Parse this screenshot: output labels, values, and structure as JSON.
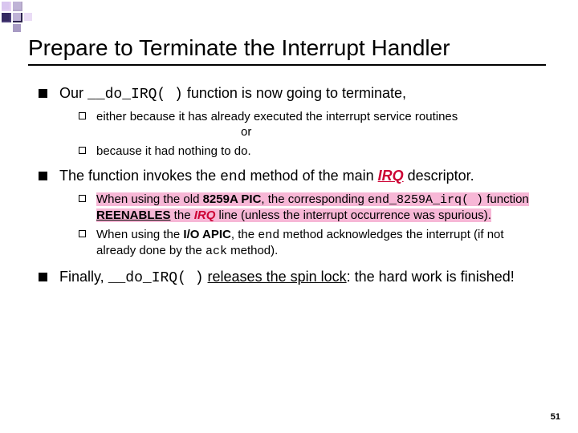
{
  "title": "Prepare to Terminate the Interrupt Handler",
  "b1": {
    "pre": "Our ",
    "code": "__do_IRQ( )",
    "post": " function is now going to terminate,",
    "sub1a": "either because it has already executed the interrupt service routines",
    "sub1b": "or",
    "sub2": "because it had nothing to do."
  },
  "b2": {
    "pre": "The function invokes the ",
    "code": "end",
    "mid": " method of the main ",
    "irq": "IRQ",
    "post": " descriptor.",
    "sub1_a": "When using the old ",
    "sub1_b": "8259A PIC",
    "sub1_c": ", the corresponding ",
    "sub1_code": "end_8259A_irq( )",
    "sub1_d": " function ",
    "sub1_e": "REENABLES",
    "sub1_f": " the ",
    "sub1_irq": "IRQ",
    "sub1_g": " line (unless the interrupt occurrence was spurious).",
    "sub2_a": "When using the ",
    "sub2_b": "I/O APIC",
    "sub2_c": ", the ",
    "sub2_code1": "end",
    "sub2_d": " method acknowledges the interrupt (if not already done by the ",
    "sub2_code2": "ack",
    "sub2_e": " method)."
  },
  "b3": {
    "pre": "Finally, ",
    "code": "__do_IRQ( )",
    "mid": " ",
    "u": "releases the spin lock",
    "post": ": the hard work is finished!"
  },
  "page": "51"
}
